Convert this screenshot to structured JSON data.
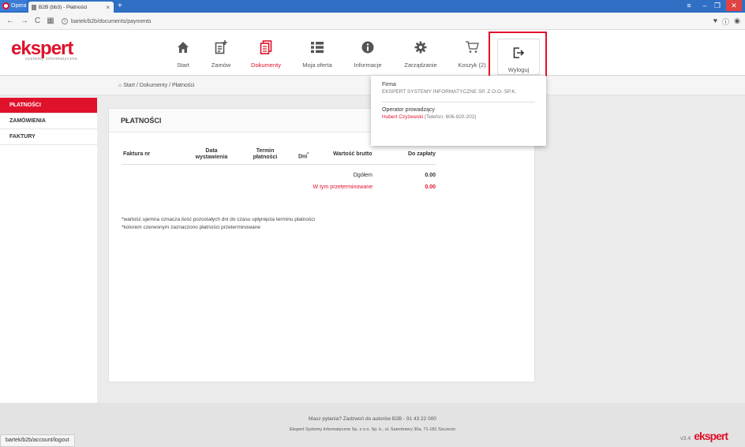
{
  "browser": {
    "opera_label": "Opera",
    "tab_title": "B2B (bb3) - Płatności",
    "url": "bartek/b2b/documents/payments",
    "status_url": "bartek/b2b/account/logout"
  },
  "brand": {
    "logo_main": "ekspert",
    "logo_sub": "systemy informatyczne",
    "accent": "#e0112b"
  },
  "nav": {
    "items": [
      {
        "label": "Start",
        "icon": "home-icon"
      },
      {
        "label": "Zamów",
        "icon": "order-icon"
      },
      {
        "label": "Dokumenty",
        "icon": "documents-icon"
      },
      {
        "label": "Moja oferta",
        "icon": "list-icon"
      },
      {
        "label": "Informacje",
        "icon": "info-icon"
      },
      {
        "label": "Zarządzanie",
        "icon": "gear-icon"
      },
      {
        "label": "Koszyk (2)",
        "icon": "cart-icon"
      },
      {
        "label": "Wyloguj",
        "icon": "logout-icon"
      }
    ],
    "active": "Dokumenty"
  },
  "dropdown": {
    "firm_label": "Firma",
    "firm_name": "EKSPERT SYSTEMY INFORMATYCZNE SP. Z O.O. SP.K.",
    "operator_label": "Operator prowadzący",
    "operator_name": "Hubert Czyżewski",
    "operator_phone": "(Telefon: 606-920-202)"
  },
  "breadcrumb": "Start / Dokumenty / Płatności",
  "sidebar": {
    "items": [
      {
        "label": "PŁATNOŚCI"
      },
      {
        "label": "ZAMÓWIENIA"
      },
      {
        "label": "FAKTURY"
      }
    ]
  },
  "panel": {
    "title": "PŁATNOŚCI",
    "columns": {
      "invoice_no": "Faktura nr",
      "issue_date_1": "Data",
      "issue_date_2": "wystawienia",
      "due_1": "Termin",
      "due_2": "płatności",
      "days": "Dni",
      "days_sup": "*",
      "gross": "Wartość brutto",
      "to_pay": "Do zapłaty"
    },
    "total_label": "Ogółem",
    "total_value": "0.00",
    "overdue_label": "W tym przeterminowane",
    "overdue_value": "0.00",
    "note1": "*wartość ujemna oznacza ilość pozostałych dni do czasu upłynięcia terminu płatności",
    "note2": "*kolorem czerwonym zaznaczono płatności przeterminowane"
  },
  "footer": {
    "question": "Masz pytania? Zadzwoń do autorów B2B - 91 43 22 000",
    "address": "Ekspert Systemy Informatyczne Sp. z o.o. Sp. k., ul. Samotniery 30a, 71-181 Szczecin",
    "version": "v3.4"
  }
}
